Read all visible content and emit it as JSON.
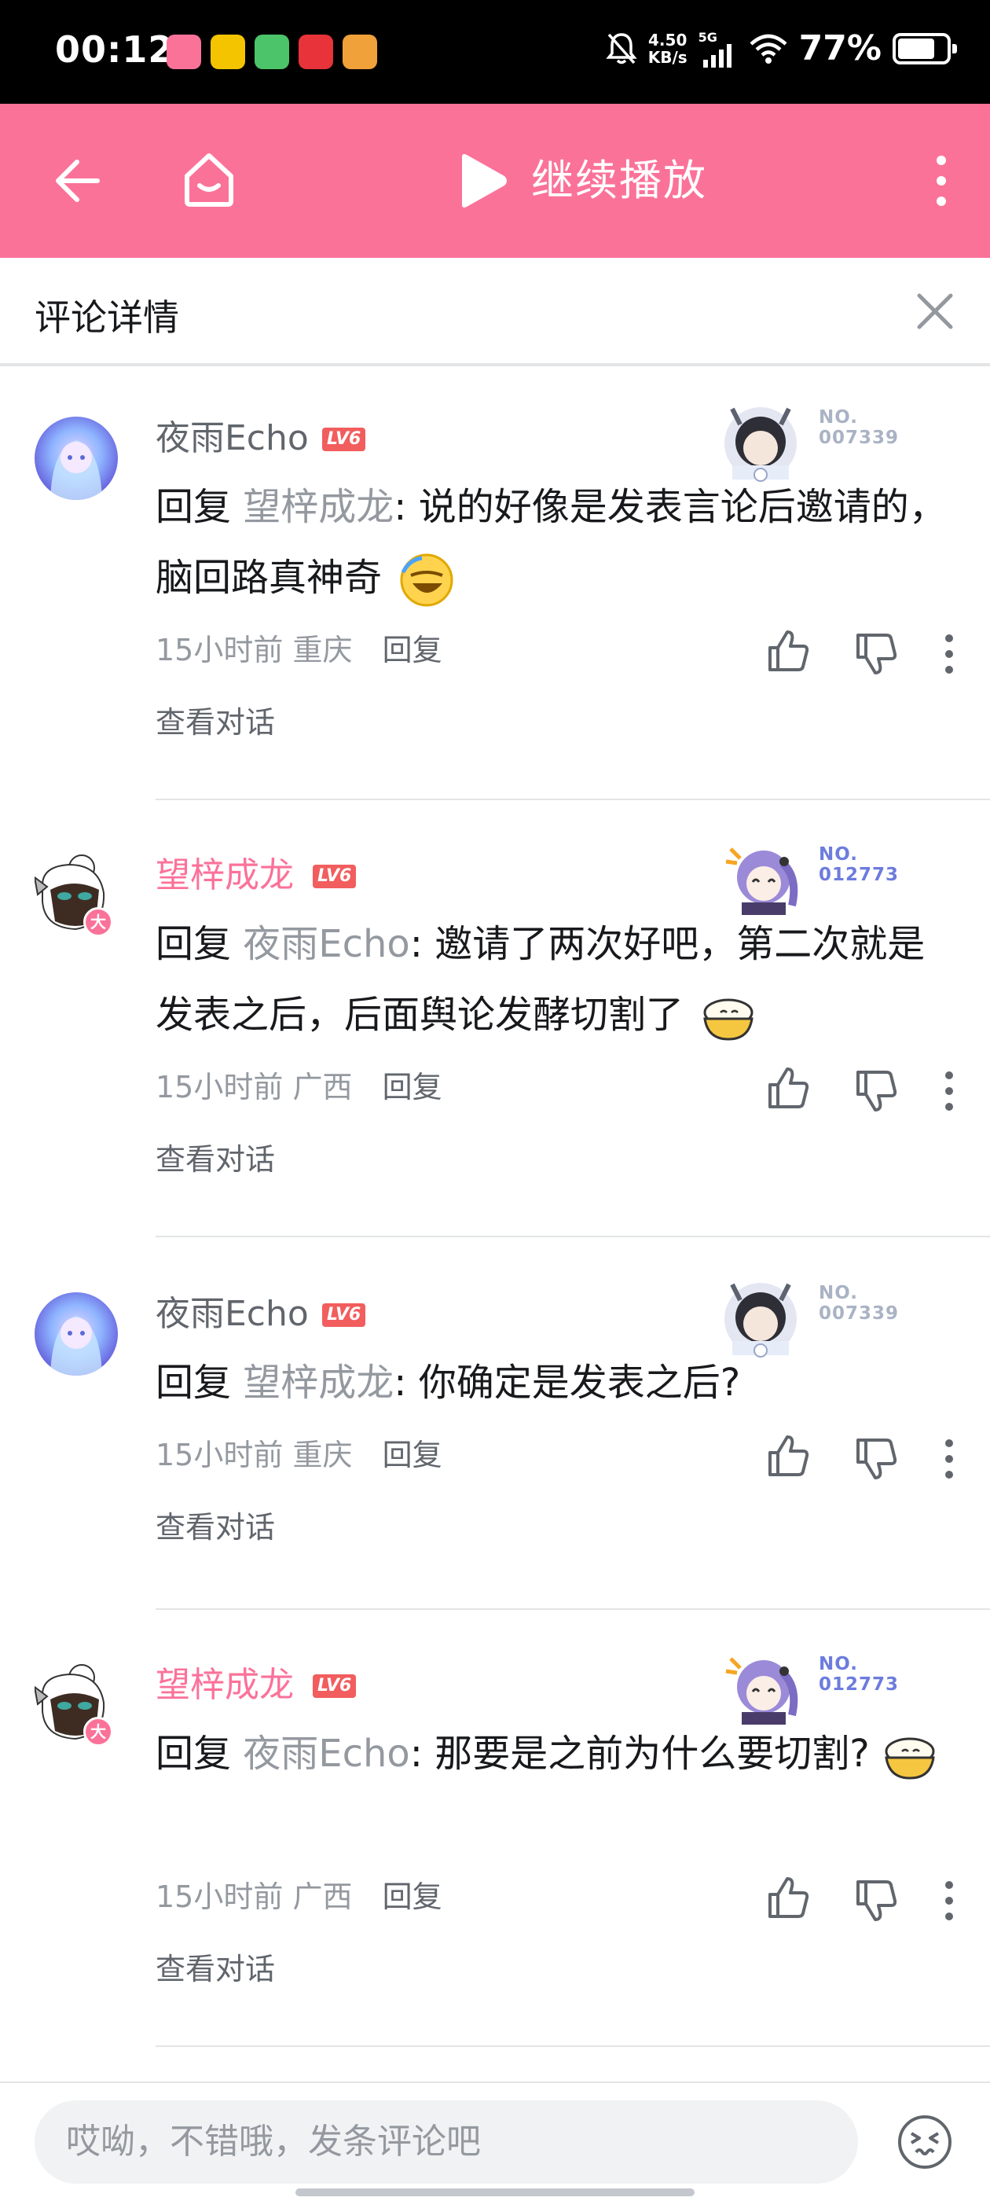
{
  "status_bar": {
    "time": "00:12",
    "net_speed_value": "4.50",
    "net_speed_unit": "KB/s",
    "network_type": "5G",
    "battery_percent": "77%",
    "battery_level": 0.77
  },
  "app_bar": {
    "continue_label": "继续播放"
  },
  "sheet": {
    "title": "评论详情"
  },
  "comments": [
    {
      "user": "夜雨Echo",
      "level": "LV6",
      "badge_no": "NO.\n007339",
      "reply_label": "回复 ",
      "reply_to": "望梓成龙",
      "text": ": 说的好像是发表言论后邀请的，脑回路真神奇",
      "time": "15小时前",
      "location": "重庆",
      "reply_button": "回复",
      "view_thread": "查看对话"
    },
    {
      "user": "望梓成龙",
      "level": "LV6",
      "badge_no": "NO.\n012773",
      "reply_label": "回复 ",
      "reply_to": "夜雨Echo",
      "text": ": 邀请了两次好吧，第二次就是发表之后，后面舆论发酵切割了",
      "time": "15小时前",
      "location": "广西",
      "reply_button": "回复",
      "view_thread": "查看对话"
    },
    {
      "user": "夜雨Echo",
      "level": "LV6",
      "badge_no": "NO.\n007339",
      "reply_label": "回复 ",
      "reply_to": "望梓成龙",
      "text": ": 你确定是发表之后?",
      "time": "15小时前",
      "location": "重庆",
      "reply_button": "回复",
      "view_thread": "查看对话"
    },
    {
      "user": "望梓成龙",
      "level": "LV6",
      "badge_no": "NO.\n012773",
      "reply_label": "回复 ",
      "reply_to": "夜雨Echo",
      "text": ": 那要是之前为什么要切割?",
      "time": "15小时前",
      "location": "广西",
      "reply_button": "回复",
      "view_thread": "查看对话"
    }
  ],
  "composer": {
    "placeholder": "哎呦，不错哦，发条评论吧"
  },
  "icons": {
    "back": "arrow-left-icon",
    "home": "home-icon",
    "play": "play-icon",
    "more": "more-vertical-icon",
    "close": "close-icon",
    "like": "thumbs-up-icon",
    "dislike": "thumbs-down-icon",
    "emoji": "emoji-face-icon"
  },
  "colors": {
    "brand_pink": "#fb7299",
    "level_red": "#f25d5d",
    "muted_text": "#9499a0"
  }
}
